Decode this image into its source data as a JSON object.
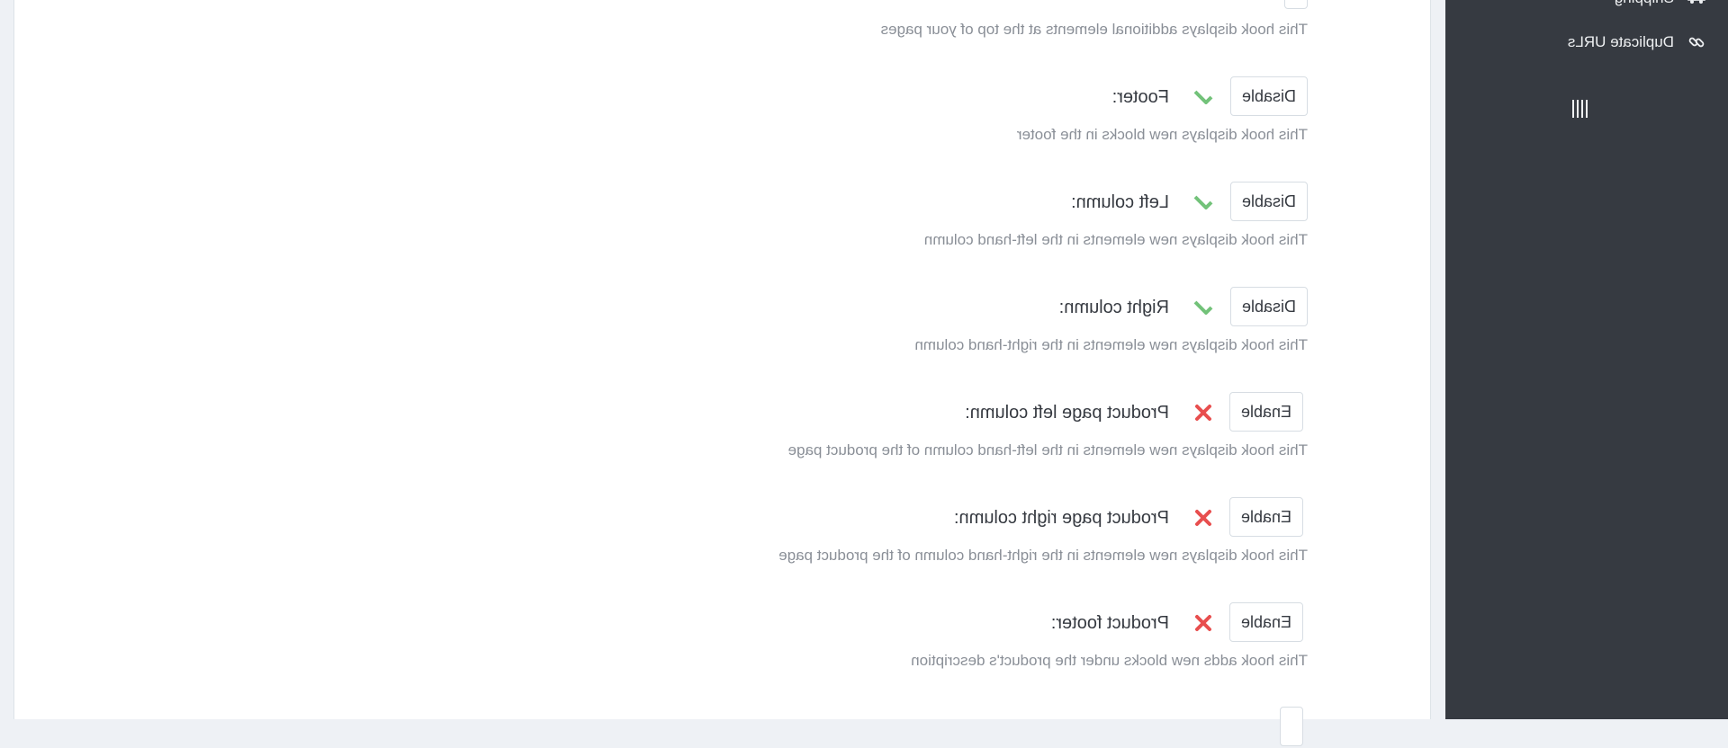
{
  "sidebar": {
    "items": [
      {
        "label": "Shipping",
        "icon": "shipping-icon"
      },
      {
        "label": "Duplicate URLs",
        "icon": "link-icon"
      }
    ]
  },
  "hooks": {
    "top": {
      "help": "This hook displays additional elements at the top of your pages"
    },
    "footer": {
      "label": "Footer:",
      "status": "enabled",
      "button": "Disable",
      "help": "This hook displays new blocks in the footer"
    },
    "left_column": {
      "label": "Left column:",
      "status": "enabled",
      "button": "Disable",
      "help": "This hook displays new elements in the left-hand column"
    },
    "right_column": {
      "label": "Right column:",
      "status": "enabled",
      "button": "Disable",
      "help": "This hook displays new elements in the right-hand column"
    },
    "product_left_column": {
      "label": "Product page left column:",
      "status": "disabled",
      "button": "Enable",
      "help": "This hook displays new elements in the left-hand column of the product page"
    },
    "product_right_column": {
      "label": "Product page right column:",
      "status": "disabled",
      "button": "Enable",
      "help": "This hook displays new elements in the right-hand column of the product page"
    },
    "product_footer": {
      "label": "Product footer:",
      "status": "disabled",
      "button": "Enable",
      "help": "This hook adds new blocks under the product's description"
    }
  },
  "colors": {
    "enabled": "#72c279",
    "disabled": "#e84e4e",
    "sidebar": "#363a41"
  }
}
